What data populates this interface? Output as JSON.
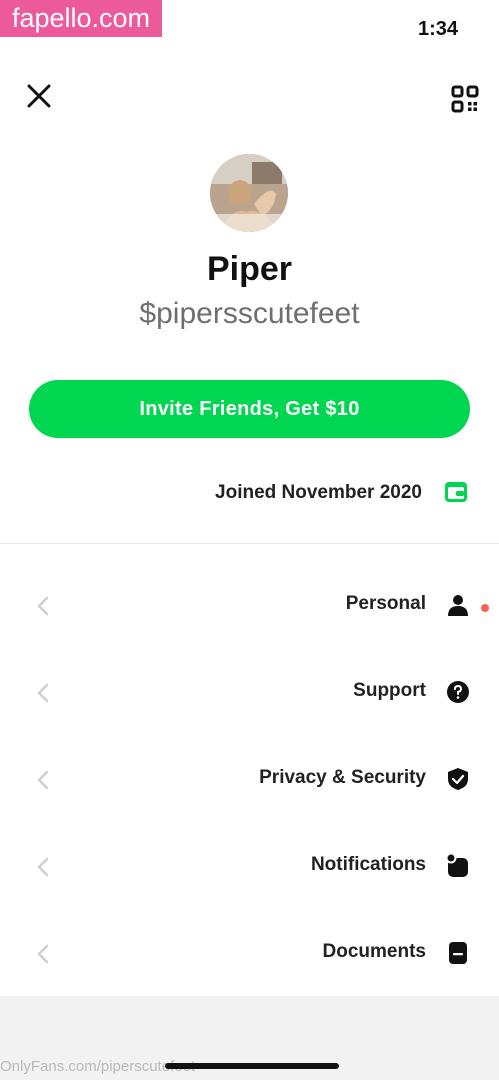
{
  "watermark": "fapello.com",
  "status": {
    "time": "1:34"
  },
  "profile": {
    "name": "Piper",
    "cashtag": "$pipersscutefeet"
  },
  "invite": {
    "label": "Invite Friends, Get $10"
  },
  "joined": {
    "text": "Joined November 2020",
    "icon": "wallet-icon"
  },
  "menu": [
    {
      "label": "Personal",
      "icon": "person-icon",
      "notification": true
    },
    {
      "label": "Support",
      "icon": "help-icon",
      "notification": false
    },
    {
      "label": "Privacy & Security",
      "icon": "shield-icon",
      "notification": false
    },
    {
      "label": "Notifications",
      "icon": "bell-icon",
      "notification": false
    },
    {
      "label": "Documents",
      "icon": "document-icon",
      "notification": false
    }
  ],
  "footer": {
    "url": "OnlyFans.com/piperscutefeet"
  },
  "colors": {
    "accent": "#00d64f",
    "watermark": "#ec5a9c",
    "dot": "#ff5d57"
  }
}
